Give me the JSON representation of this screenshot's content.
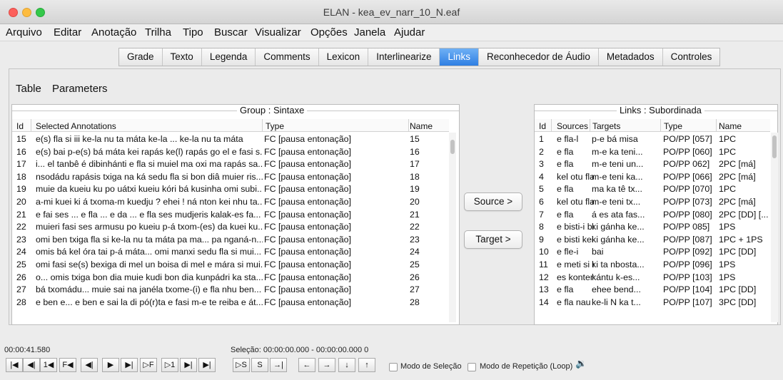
{
  "window": {
    "title": "ELAN - kea_ev_narr_10_N.eaf"
  },
  "menu": [
    "Arquivo",
    "Editar",
    "Anotação",
    "Trilha",
    "Tipo",
    "Buscar",
    "Visualizar",
    "Opções",
    "Janela",
    "Ajudar"
  ],
  "tabs": [
    "Grade",
    "Texto",
    "Legenda",
    "Comments",
    "Lexicon",
    "Interlinearize",
    "Links",
    "Reconhecedor de Áudio",
    "Metadados",
    "Controles"
  ],
  "active_tab": "Links",
  "subtabs": [
    "Table",
    "Parameters"
  ],
  "left_panel": {
    "title": "Group : Sintaxe",
    "headers": [
      "Id",
      "Selected Annotations",
      "Type",
      "Name"
    ],
    "rows": [
      [
        "15",
        "e(s) fla si iii ke-la nu ta máta ke-la ... ke-la nu ta máta",
        "FC [pausa entonação]",
        "15"
      ],
      [
        "16",
        "e(s) bai p-e(s) bá máta kei rapás ke(l) rapás go el e fasi s...",
        "FC [pausa entonação]",
        "16"
      ],
      [
        "17",
        "i... el tanbê é dibinhánti e fla si muiel ma oxi ma rapás sa...",
        "FC [pausa entonação]",
        "17"
      ],
      [
        "18",
        "nsodádu rapásis txiga na ká sedu fla si bon diâ muier ris...",
        "FC [pausa entonação]",
        "18"
      ],
      [
        "19",
        "muie da kueiu ku po uátxi kueiu kóri bá kusinha omi subi...",
        "FC [pausa entonação]",
        "19"
      ],
      [
        "20",
        "a-mi kuei ki á txoma-m kuedju ? ehei ! ná nton kei nhu ta...",
        "FC [pausa entonação]",
        "20"
      ],
      [
        "21",
        "e fai ses ... e fla ... e da ... e fla ses mudjeris kalak-es fa...",
        "FC [pausa entonação]",
        "21"
      ],
      [
        "22",
        "muieri fasi ses armusu po kueiu p-á txom-(es) da kuei ku...",
        "FC [pausa entonação]",
        "22"
      ],
      [
        "23",
        "omi ben txiga fla si ke-la nu ta máta pa ma... pa nganá-n...",
        "FC [pausa entonação]",
        "23"
      ],
      [
        "24",
        "omis bá kel óra tai p-á máta... omi manxi sedu fla si mui...",
        "FC [pausa entonação]",
        "24"
      ],
      [
        "25",
        "omi fasi se(s) bexiga di mel un boisa di mel e mára si mui...",
        "FC [pausa entonação]",
        "25"
      ],
      [
        "26",
        "o... omis txiga bon dia muie kudi bon dia kunpádri ka sta...",
        "FC [pausa entonação]",
        "26"
      ],
      [
        "27",
        "bá txomádu... muie sai na janéla txome-(i) e fla nhu ben...",
        "FC [pausa entonação]",
        "27"
      ],
      [
        "28",
        "e ben e... e ben e sai la di pó(r)ta e fasi m-e te reiba e át...",
        "FC [pausa entonação]",
        "28"
      ]
    ]
  },
  "buttons": {
    "source": "Source >",
    "target": "Target >"
  },
  "right_panel": {
    "title": "Links : Subordinada",
    "headers": [
      "Id",
      "Sources",
      "Targets",
      "Type",
      "Name"
    ],
    "rows": [
      [
        "1",
        "e fla-l",
        "p-e bá misa",
        "PO/PP [057]",
        "1PC"
      ],
      [
        "2",
        "e fla",
        "m-e ka teni...",
        "PO/PP [060]",
        "1PC"
      ],
      [
        "3",
        "e fla",
        "m-e teni un...",
        "PO/PP 062]",
        "2PC [má]"
      ],
      [
        "4",
        "kel otu fla",
        "m-e teni ka...",
        "PO/PP [066]",
        "2PC [má]"
      ],
      [
        "5",
        "e fla",
        "ma ka tê tx...",
        "PO/PP [070]",
        "1PC"
      ],
      [
        "6",
        "kel otu fla-i",
        "m-e teni tx...",
        "PO/PP [073]",
        "2PC [má]"
      ],
      [
        "7",
        "e fla",
        "á es ata fas...",
        "PO/PP [080]",
        "2PC [DD] [..."
      ],
      [
        "8",
        "e bisti-i be...",
        "ki gánha ke...",
        "PO/PP 085]",
        "1PS"
      ],
      [
        "9",
        "e bisti kei k...",
        "ki gánha ke...",
        "PO/PP [087]",
        "1PC + 1PS"
      ],
      [
        "10",
        "e fle-i",
        "bai",
        "PO/PP [092]",
        "1PC [DD]"
      ],
      [
        "11",
        "e meti si m...",
        "ki ta nbosta...",
        "PO/PP [096]",
        "1PS"
      ],
      [
        "12",
        "es kontenti...",
        "kántu k-es...",
        "PO/PP [103]",
        "1PS"
      ],
      [
        "13",
        "e fla",
        "ehee bend...",
        "PO/PP [104]",
        "1PC [DD]"
      ],
      [
        "14",
        "e fla nau",
        "ke-li N ka t...",
        "PO/PP [107]",
        "3PC [DD]"
      ]
    ]
  },
  "player": {
    "timecode": "00:00:41.580",
    "selection": "Seleção: 00:00:00.000 - 00:00:00.000  0",
    "controls": [
      "|◀",
      "◀|",
      "1◀",
      "F◀",
      "◀|",
      "▶",
      "▶|",
      "▷F",
      "▷1",
      "▶|",
      "▶|",
      "▷S",
      "S",
      "→|",
      "←",
      "→",
      "↓",
      "↑"
    ],
    "selection_mode_label": "Modo de Seleção",
    "loop_mode_label": "Modo de Repetição (Loop)"
  }
}
